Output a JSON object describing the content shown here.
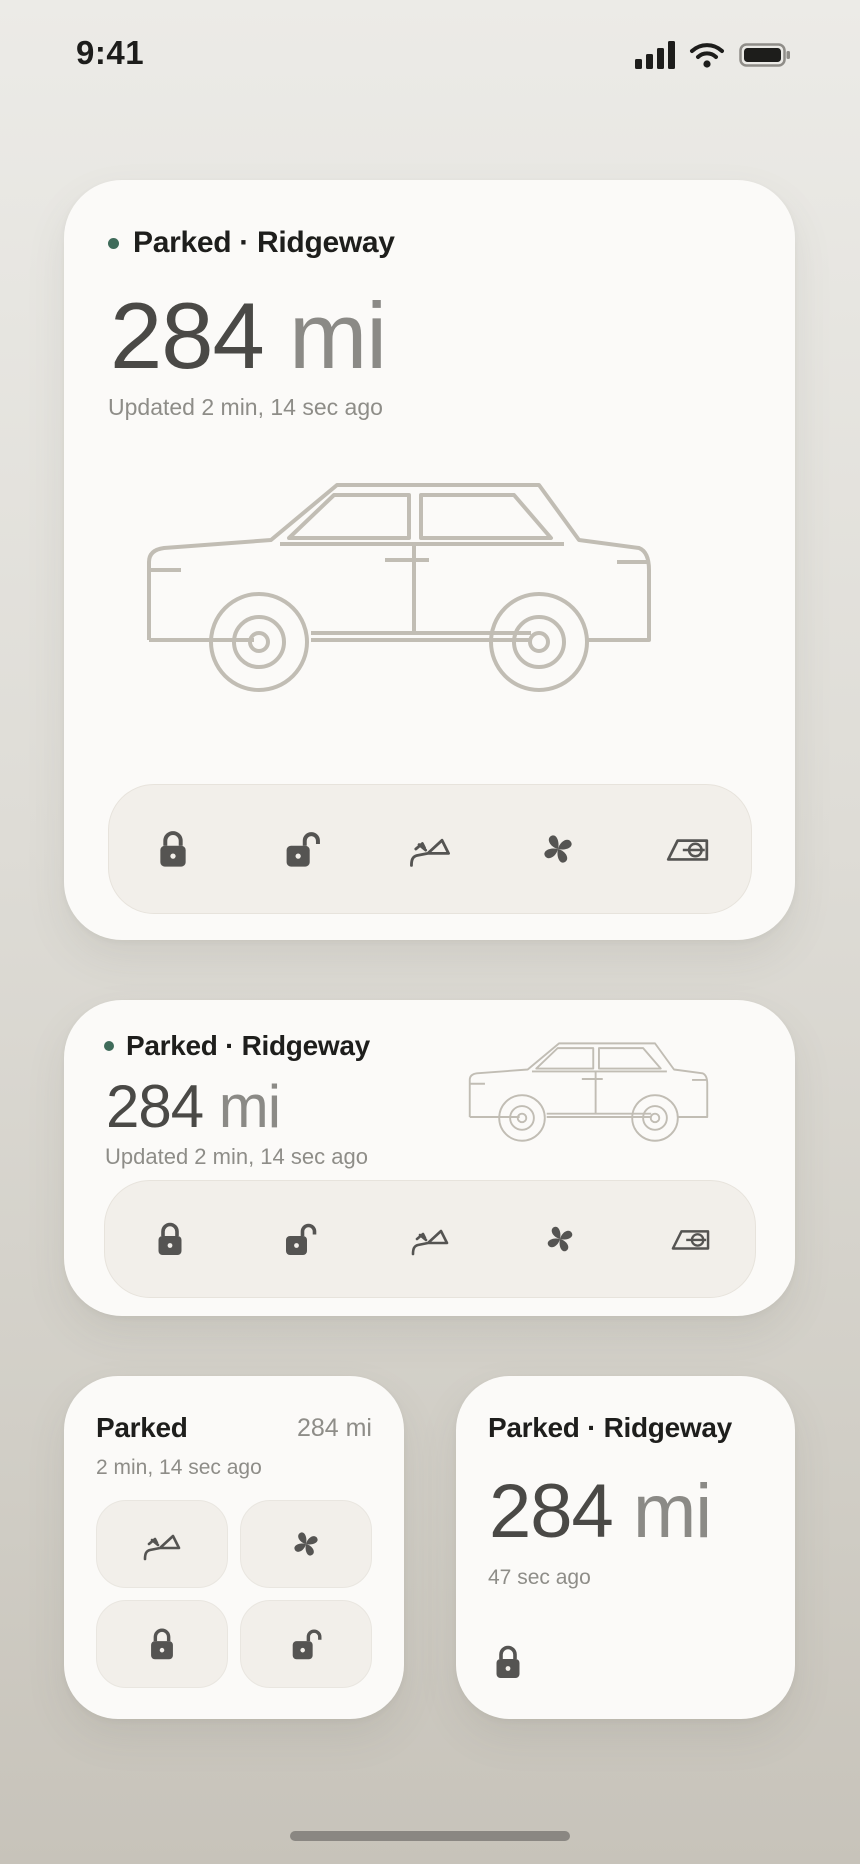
{
  "status_bar": {
    "time": "9:41",
    "icons": [
      "cellular-signal-icon",
      "wifi-icon",
      "battery-icon"
    ]
  },
  "vehicle": {
    "status": "Parked · Ridgeway",
    "status_short": "Parked",
    "range_value": "284",
    "range_unit": "mi",
    "range_compact": "284 mi",
    "updated": "Updated 2 min, 14 sec ago",
    "updated_short": "2 min, 14 sec ago",
    "updated_recent": "47 sec ago",
    "status_color": "#3f6b5a"
  },
  "controls": [
    {
      "name": "lock",
      "icon": "lock-icon"
    },
    {
      "name": "unlock",
      "icon": "unlock-icon"
    },
    {
      "name": "trunk",
      "icon": "trunk-icon"
    },
    {
      "name": "climate",
      "icon": "fan-icon"
    },
    {
      "name": "charge-port",
      "icon": "charge-port-icon"
    }
  ]
}
